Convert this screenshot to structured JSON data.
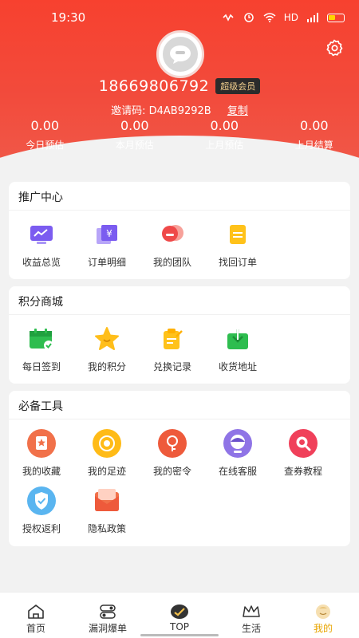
{
  "status": {
    "time": "19:30",
    "network": "HD"
  },
  "profile": {
    "phone": "18669806792",
    "vip_badge": "超级会员",
    "invite_label": "邀请码: D4AB9292B",
    "copy_label": "复制"
  },
  "stats": [
    {
      "value": "0.00",
      "label": "今日预估"
    },
    {
      "value": "0.00",
      "label": "本月预估"
    },
    {
      "value": "0.00",
      "label": "上月预估"
    },
    {
      "value": "0.00",
      "label": "上月结算"
    }
  ],
  "promo": {
    "title": "推广中心",
    "items": [
      {
        "label": "收益总览",
        "icon": "chart-icon"
      },
      {
        "label": "订单明细",
        "icon": "order-icon"
      },
      {
        "label": "我的团队",
        "icon": "team-icon"
      },
      {
        "label": "找回订单",
        "icon": "recover-order-icon"
      }
    ]
  },
  "points": {
    "title": "积分商城",
    "items": [
      {
        "label": "每日签到",
        "icon": "calendar-icon"
      },
      {
        "label": "我的积分",
        "icon": "star-icon"
      },
      {
        "label": "兑换记录",
        "icon": "exchange-icon"
      },
      {
        "label": "收货地址",
        "icon": "address-icon"
      }
    ]
  },
  "tools": {
    "title": "必备工具",
    "items": [
      {
        "label": "我的收藏",
        "icon": "favorite-icon"
      },
      {
        "label": "我的足迹",
        "icon": "footprint-icon"
      },
      {
        "label": "我的密令",
        "icon": "key-icon"
      },
      {
        "label": "在线客服",
        "icon": "service-icon"
      },
      {
        "label": "查券教程",
        "icon": "search-coupon-icon"
      },
      {
        "label": "授权返利",
        "icon": "shield-icon"
      },
      {
        "label": "隐私政策",
        "icon": "mail-icon"
      }
    ]
  },
  "nav": {
    "items": [
      {
        "label": "首页"
      },
      {
        "label": "漏洞爆单"
      },
      {
        "label": "TOP"
      },
      {
        "label": "生活"
      },
      {
        "label": "我的"
      }
    ]
  },
  "colors": {
    "header": "#f24b3c",
    "vip_gold": "#f3d08e",
    "nav_active": "#e8a500"
  }
}
